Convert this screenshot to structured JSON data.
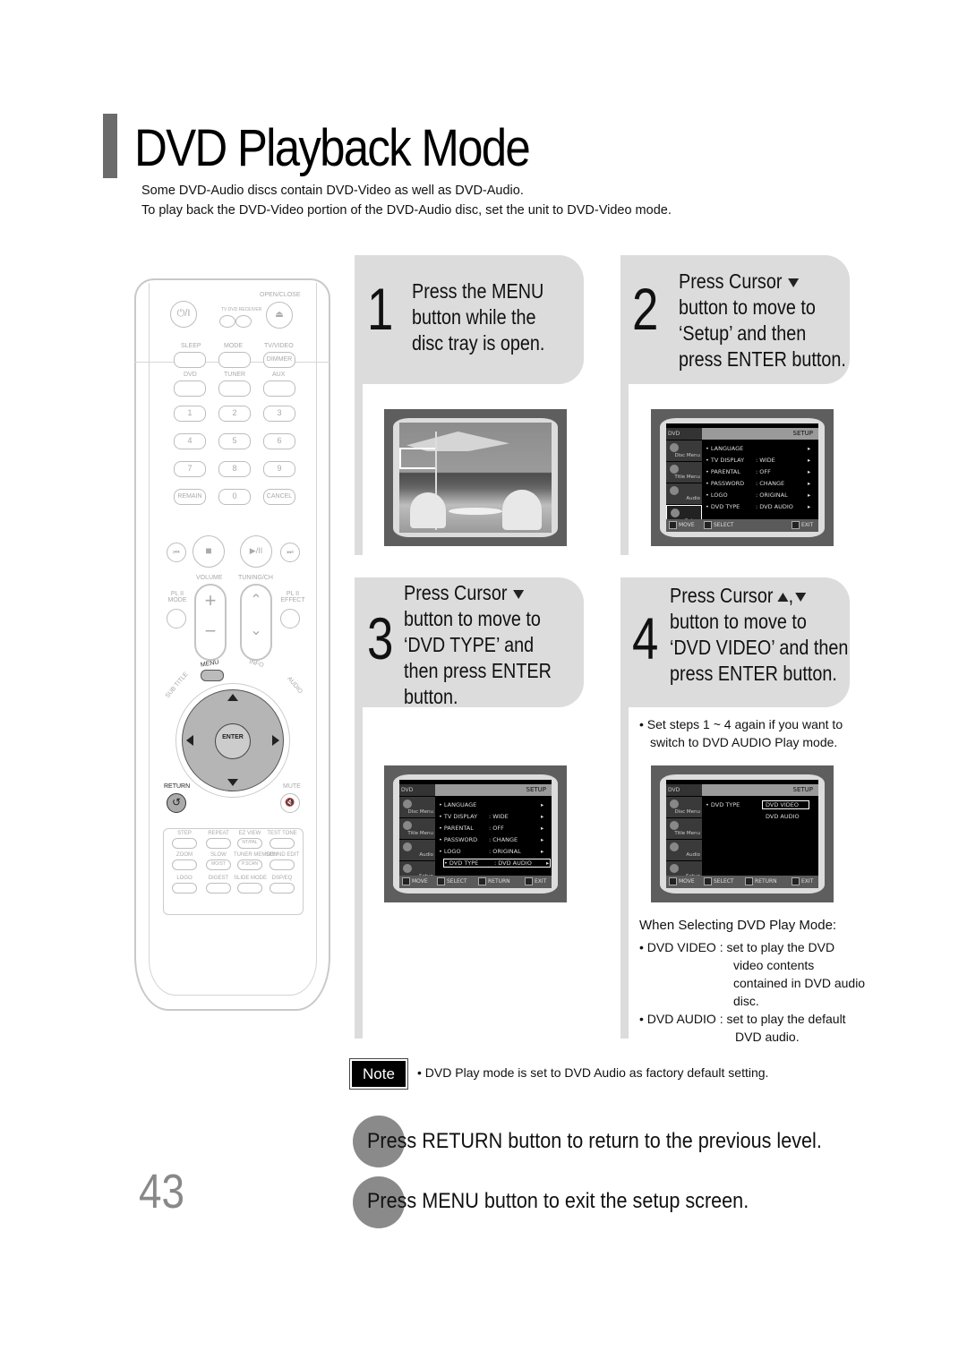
{
  "header": {
    "title": "DVD Playback Mode",
    "intro_lines": [
      "Some DVD-Audio discs contain DVD-Video as well as DVD-Audio.",
      "To play back the DVD-Video portion of the DVD-Audio disc, set the unit to DVD-Video mode."
    ]
  },
  "remote": {
    "labels": {
      "open_close": "OPEN/CLOSE",
      "power": "⏻/I",
      "tv": "TV",
      "dvd_receiver": "DVD RECEIVER",
      "eject": "⏏",
      "sleep": "SLEEP",
      "mode": "MODE",
      "tv_video": "TV/VIDEO",
      "dimmer": "DIMMER",
      "dvd": "DVD",
      "tuner": "TUNER",
      "aux": "AUX",
      "remain": "REMAIN",
      "cancel": "CANCEL",
      "volume": "VOLUME",
      "tuning_ch": "TUNING/CH",
      "pl2_mode": "PL II MODE",
      "pl2_effect": "PL II EFFECT",
      "menu": "MENU",
      "info": "INFO",
      "subtitle": "SUB TITLE",
      "audio": "AUDIO",
      "enter": "ENTER",
      "return": "RETURN",
      "mute": "MUTE",
      "plus": "+",
      "minus": "−"
    },
    "digits": [
      "1",
      "2",
      "3",
      "4",
      "5",
      "6",
      "7",
      "8",
      "9",
      "0"
    ],
    "transport": [
      "⏮",
      "■",
      "▶/II",
      "⏭"
    ],
    "bottom_grid": [
      {
        "label": "STEP",
        "sub": ""
      },
      {
        "label": "REPEAT",
        "sub": ""
      },
      {
        "label": "EZ VIEW",
        "sub": "NT/PAL"
      },
      {
        "label": "TEST TONE",
        "sub": ""
      },
      {
        "label": "ZOOM",
        "sub": ""
      },
      {
        "label": "SLOW",
        "sub": "MO/ST"
      },
      {
        "label": "TUNER MEMORY",
        "sub": "P.SCAN"
      },
      {
        "label": "SOUND EDIT",
        "sub": ""
      },
      {
        "label": "LOGO",
        "sub": ""
      },
      {
        "label": "DIGEST",
        "sub": ""
      },
      {
        "label": "SLIDE MODE",
        "sub": ""
      },
      {
        "label": "DSP/EQ",
        "sub": ""
      }
    ]
  },
  "steps": [
    {
      "num": "1",
      "lines": [
        "Press the MENU",
        "button while the",
        "disc tray is open."
      ]
    },
    {
      "num": "2",
      "lines": [
        "Press Cursor",
        "button to move to",
        "‘Setup’ and then",
        "press ENTER button."
      ]
    },
    {
      "num": "3",
      "lines": [
        "Press Cursor",
        "button to move to",
        "‘DVD TYPE’ and",
        "then press ENTER",
        "button."
      ]
    },
    {
      "num": "4",
      "lines": [
        "Press Cursor",
        "button to move to",
        "‘DVD VIDEO’ and then",
        "press ENTER button."
      ]
    }
  ],
  "osd": {
    "brand": "DVD RECEIVER",
    "setup_title": "SETUP",
    "tabs": [
      "Disc Menu",
      "Title Menu",
      "Audio",
      "Setup"
    ],
    "setup_menu": [
      {
        "item": "LANGUAGE",
        "value": ""
      },
      {
        "item": "TV DISPLAY",
        "value": "WIDE"
      },
      {
        "item": "PARENTAL",
        "value": "OFF"
      },
      {
        "item": "PASSWORD",
        "value": "CHANGE"
      },
      {
        "item": "LOGO",
        "value": "ORIGINAL"
      },
      {
        "item": "DVD TYPE",
        "value": "DVD AUDIO"
      }
    ],
    "dvd_type_options": [
      "DVD VIDEO",
      "DVD AUDIO"
    ],
    "dvd_type_label": "DVD TYPE",
    "footer": {
      "move": "MOVE",
      "select": "SELECT",
      "return": "RETURN",
      "exit": "EXIT"
    }
  },
  "step4_note": [
    "Set steps 1 ~ 4 again if you want to",
    "switch to DVD AUDIO Play mode."
  ],
  "play_mode": {
    "heading": "When Selecting DVD Play Mode:",
    "items": [
      {
        "term": "DVD VIDEO :",
        "desc": [
          "set to play the DVD",
          "video contents",
          "contained in DVD audio",
          "disc."
        ]
      },
      {
        "term": "DVD AUDIO :",
        "desc": [
          "set to play the default",
          "DVD audio."
        ]
      }
    ]
  },
  "note": {
    "label": "Note",
    "text": "DVD Play mode is set to DVD Audio as factory default setting."
  },
  "tips": [
    "Press RETURN button to return to the previous level.",
    "Press MENU button to exit the setup screen."
  ],
  "page_number": "43",
  "colors": {
    "accent_bar": "#6b6b6b",
    "step_bg": "#dcdcdc",
    "circle": "#8a8a8a",
    "page_number": "#888888"
  }
}
